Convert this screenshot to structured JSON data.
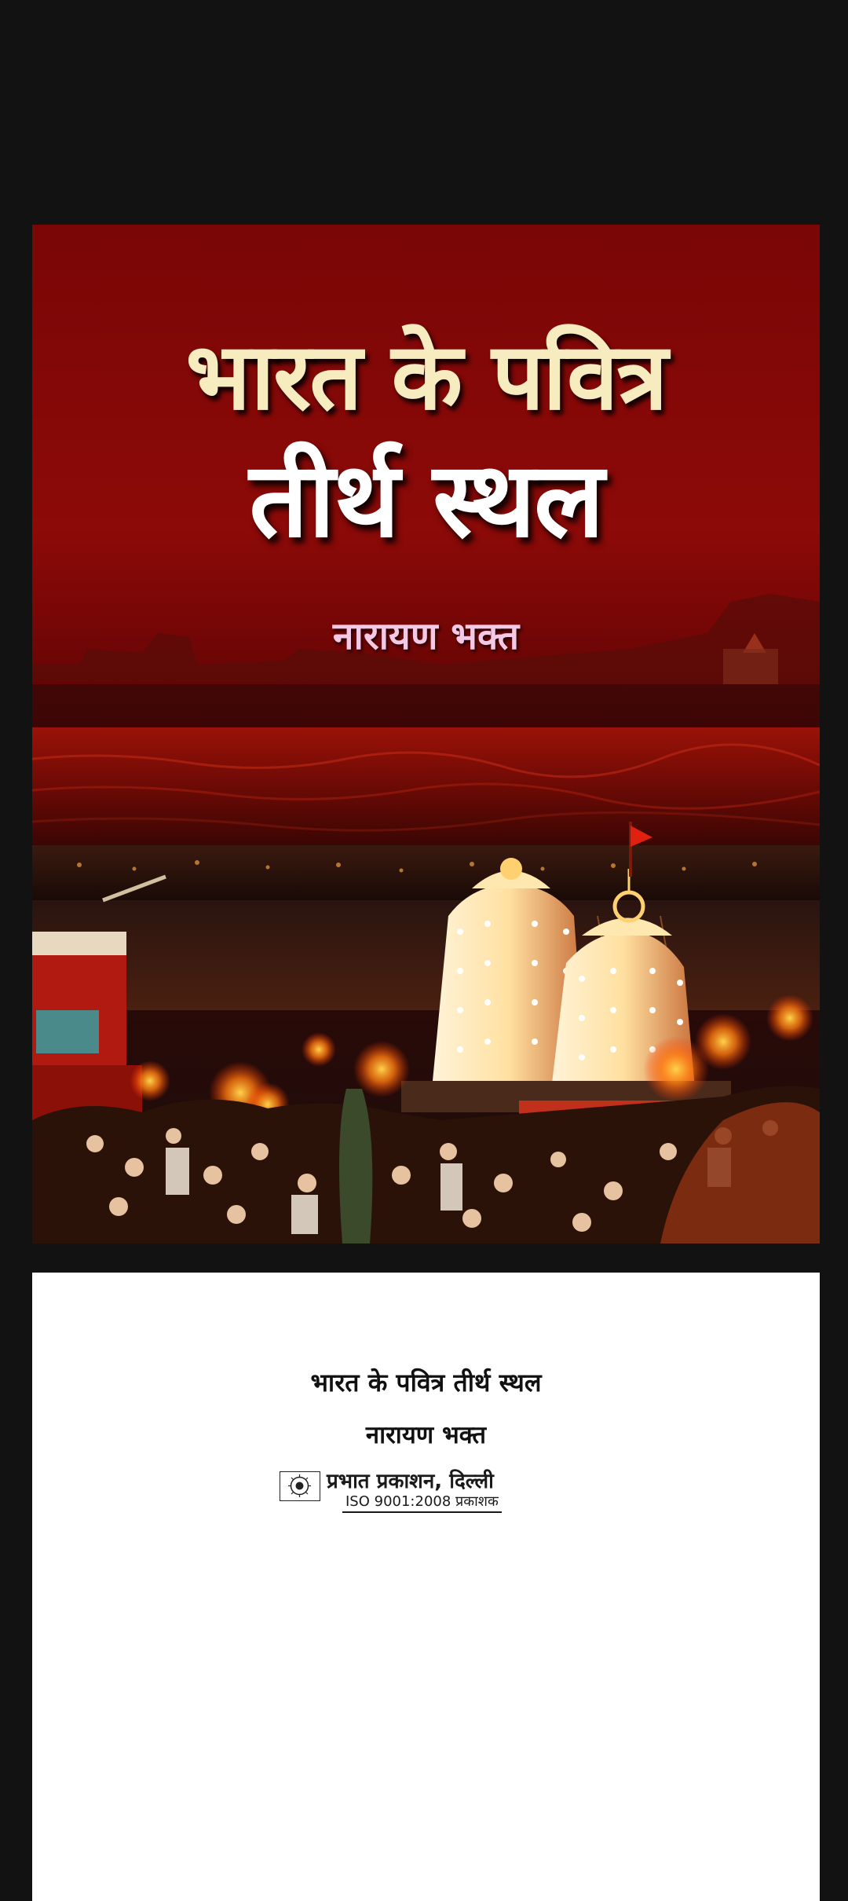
{
  "cover": {
    "title_line1": "भारत के पवित्र",
    "title_line2": "तीर्थ स्थल",
    "author": "नारायण भक्त"
  },
  "title_page": {
    "title": "भारत के पवित्र तीर्थ स्थल",
    "author": "नारायण भक्त",
    "publisher": "प्रभात प्रकाशन, दिल्ली",
    "publisher_tagline": "ISO 9001:2008 प्रकाशक"
  },
  "colors": {
    "background": "#121212",
    "cover_red": "#8c0a08",
    "title_cream": "#f6ecc0",
    "author_pink": "#f3c9e6",
    "page_white": "#ffffff"
  }
}
